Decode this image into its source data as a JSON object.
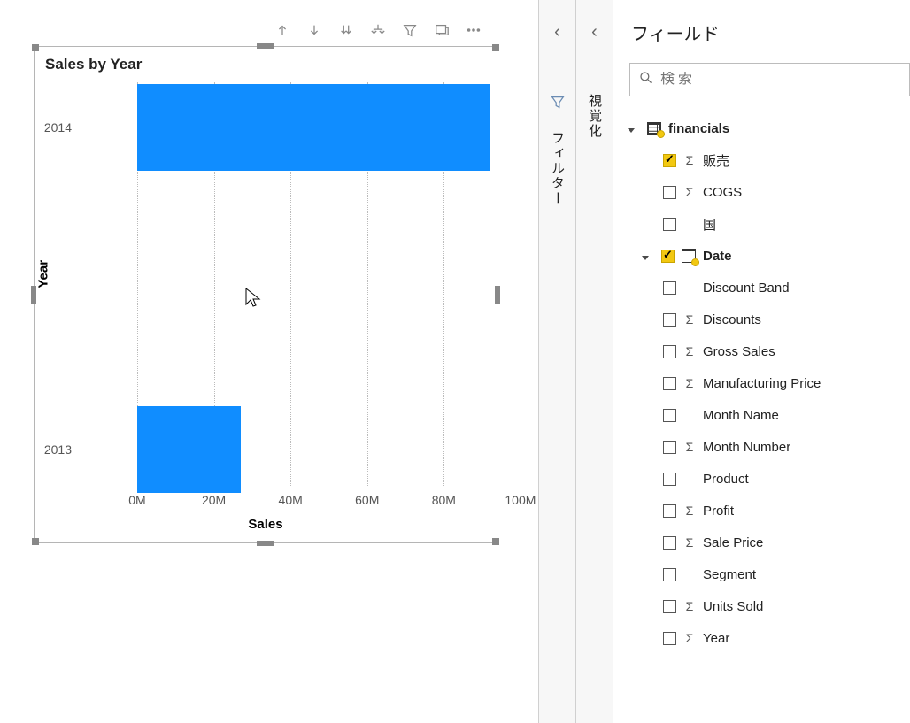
{
  "panes": {
    "filter_label": "フィルター",
    "viz_label": "視覚化",
    "fields_title": "フィールド"
  },
  "search": {
    "placeholder": "検索"
  },
  "tree": {
    "table_name": "financials",
    "date_field": "Date",
    "fields": {
      "sales": "販売",
      "cogs": "COGS",
      "country": "国",
      "discount_band": "Discount Band",
      "discounts": "Discounts",
      "gross_sales": "Gross Sales",
      "mfg_price": "Manufacturing Price",
      "month_name": "Month Name",
      "month_number": "Month Number",
      "product": "Product",
      "profit": "Profit",
      "sale_price": "Sale Price",
      "segment": "Segment",
      "units_sold": "Units Sold",
      "year": "Year"
    }
  },
  "chart": {
    "title": "Sales by Year",
    "xlabel": "Sales",
    "ylabel": "Year",
    "ticks": {
      "x0": "0M",
      "x20": "20M",
      "x40": "40M",
      "x60": "60M",
      "x80": "80M",
      "x100": "100M"
    },
    "cats": {
      "c2014": "2014",
      "c2013": "2013"
    }
  },
  "chart_data": {
    "type": "bar",
    "orientation": "horizontal",
    "categories": [
      "2014",
      "2013"
    ],
    "values": [
      92,
      27
    ],
    "units": "M",
    "xlabel": "Sales",
    "ylabel": "Year",
    "xlim": [
      0,
      100
    ],
    "title": "Sales by Year"
  }
}
